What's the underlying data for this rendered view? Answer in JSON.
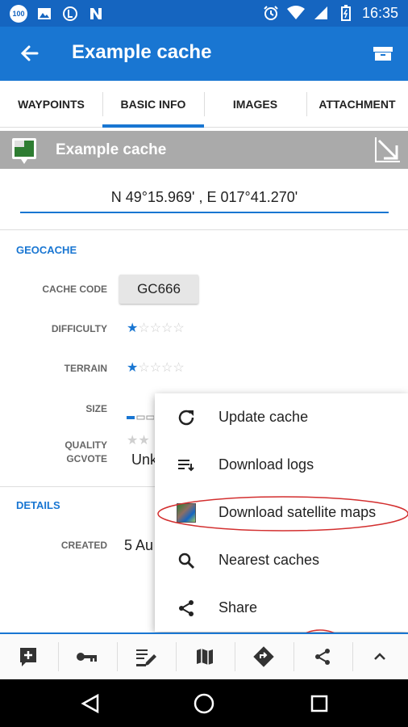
{
  "status_bar": {
    "badge": "100",
    "time": "16:35",
    "icons": [
      "image-icon",
      "locus-icon",
      "n-icon",
      "alarm-icon",
      "wifi-icon",
      "signal-icon",
      "battery-icon"
    ]
  },
  "app_bar": {
    "title": "Example cache",
    "back_icon": "arrow-left-icon",
    "action_icon": "archive-icon"
  },
  "tabs": [
    {
      "label": "WAYPOINTS",
      "active": false
    },
    {
      "label": "BASIC INFO",
      "active": true
    },
    {
      "label": "IMAGES",
      "active": false
    },
    {
      "label": "ATTACHMENT",
      "active": false
    }
  ],
  "cache_header": {
    "name": "Example cache",
    "icon": "traditional-cache-icon",
    "expand_icon": "expand-arrow-icon"
  },
  "coordinates": "N 49°15.969' , E 017°41.270'",
  "geocache": {
    "section_title": "GEOCACHE",
    "cache_code_label": "CACHE CODE",
    "cache_code": "GC666",
    "difficulty_label": "DIFFICULTY",
    "difficulty_rating": 1,
    "terrain_label": "TERRAIN",
    "terrain_rating": 1,
    "rating_max": 5,
    "size_label": "SIZE",
    "quality_label": "QUALITY",
    "gcvote_label": "GCVOTE",
    "gcvote_value": "Unk"
  },
  "details": {
    "section_title": "DETAILS",
    "created_label": "CREATED",
    "created_value": "5 Au"
  },
  "popup_menu": [
    {
      "label": "Update cache",
      "icon": "refresh-icon"
    },
    {
      "label": "Download logs",
      "icon": "download-logs-icon"
    },
    {
      "label": "Download satellite maps",
      "icon": "satellite-map-icon"
    },
    {
      "label": "Nearest caches",
      "icon": "search-icon"
    },
    {
      "label": "Share",
      "icon": "share-icon"
    }
  ],
  "bottom_bar": {
    "icons": [
      "add-note-icon",
      "key-icon",
      "edit-log-icon",
      "map-icon",
      "navigate-icon",
      "share-icon",
      "chevron-up-icon"
    ]
  },
  "colors": {
    "status_bar": "#1565c0",
    "app_bar": "#1976d2",
    "accent": "#1976d2",
    "annotation": "#d32f2f"
  }
}
